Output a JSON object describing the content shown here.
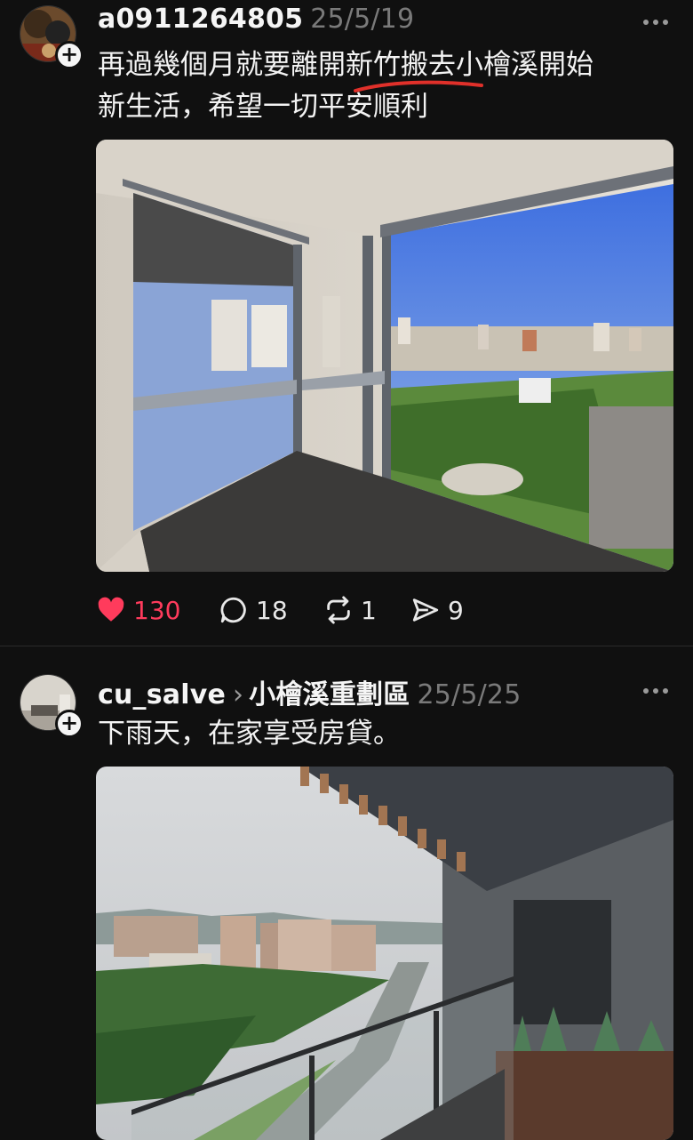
{
  "posts": [
    {
      "username": "a0911264805",
      "timestamp": "25/5/19",
      "text_line1": "再過幾個月就要離開新竹搬去小檜溪開始",
      "text_line2": "新生活，希望一切平安順利",
      "likes": "130",
      "comments": "18",
      "reposts": "1",
      "shares": "9",
      "colors": {
        "like": "#ff3b5c",
        "underline": "#e0302a"
      }
    },
    {
      "username": "cu_salve",
      "location": "小檜溪重劃區",
      "timestamp": "25/5/25",
      "text": "下雨天，在家享受房貸。"
    }
  ],
  "icons": {
    "follow": "+",
    "heart": "heart-icon",
    "comment": "comment-icon",
    "repost": "repost-icon",
    "share": "share-icon",
    "more": "more-icon"
  }
}
